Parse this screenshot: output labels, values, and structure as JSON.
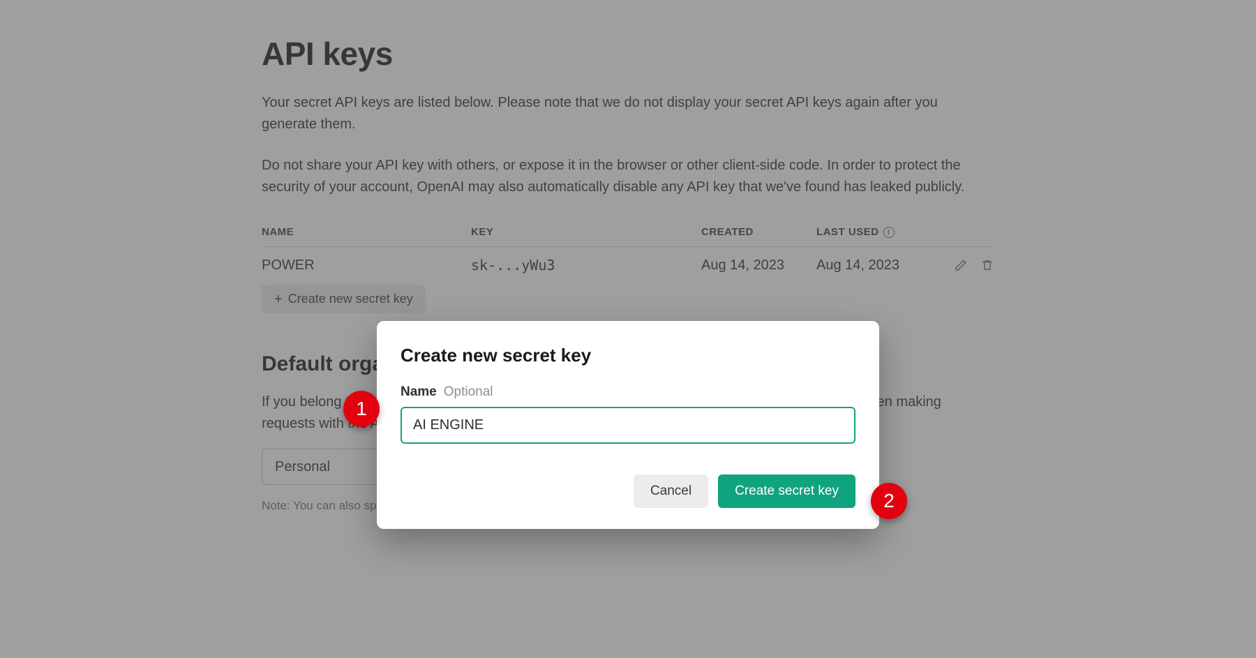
{
  "page": {
    "title": "API keys",
    "description1": "Your secret API keys are listed below. Please note that we do not display your secret API keys again after you generate them.",
    "description2": "Do not share your API key with others, or expose it in the browser or other client-side code. In order to protect the security of your account, OpenAI may also automatically disable any API key that we've found has leaked publicly."
  },
  "table": {
    "headers": {
      "name": "NAME",
      "key": "KEY",
      "created": "CREATED",
      "last_used": "LAST USED"
    },
    "rows": [
      {
        "name": "POWER",
        "key": "sk-...yWu3",
        "created": "Aug 14, 2023",
        "last_used": "Aug 14, 2023"
      }
    ]
  },
  "create_button": "Create new secret key",
  "org_section": {
    "title": "Default organization",
    "description": "If you belong to multiple organizations, this setting controls which organization is used by default when making requests with the API keys above.",
    "select_value": "Personal",
    "note": "Note: You can also specify which organization to use for each API request. See Authentication to learn more."
  },
  "modal": {
    "title": "Create new secret key",
    "field_label": "Name",
    "field_hint": "Optional",
    "input_value": "AI ENGINE",
    "cancel": "Cancel",
    "submit": "Create secret key"
  },
  "annotations": {
    "badge1": "1",
    "badge2": "2"
  }
}
